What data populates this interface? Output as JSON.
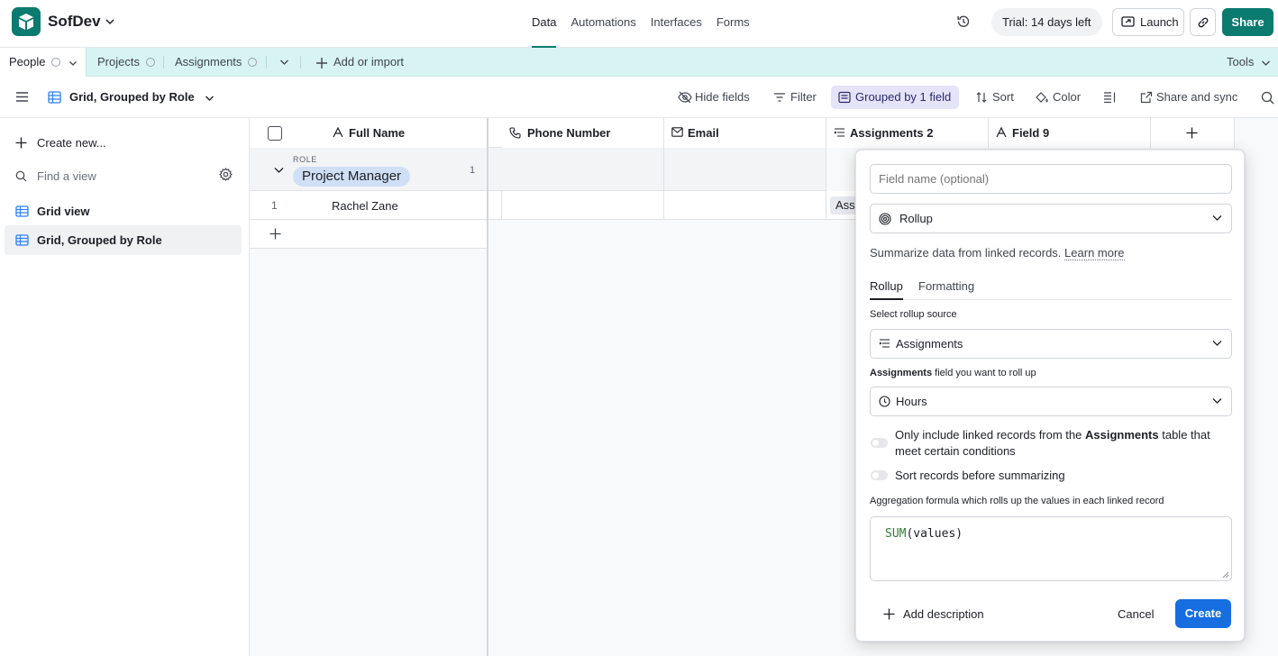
{
  "app": {
    "name": "SofDev"
  },
  "nav": {
    "tabs": [
      "Data",
      "Automations",
      "Interfaces",
      "Forms"
    ],
    "active": "Data"
  },
  "topright": {
    "trial": "Trial: 14 days left",
    "launch": "Launch",
    "share": "Share"
  },
  "tables": {
    "items": [
      "People",
      "Projects",
      "Assignments"
    ],
    "add": "Add or import",
    "tools": "Tools"
  },
  "viewbar": {
    "view_name": "Grid, Grouped by Role",
    "hide_fields": "Hide fields",
    "filter": "Filter",
    "grouped": "Grouped by 1 field",
    "sort": "Sort",
    "color": "Color",
    "share_sync": "Share and sync"
  },
  "sidebar": {
    "create": "Create new...",
    "find_placeholder": "Find a view",
    "views": [
      "Grid view",
      "Grid, Grouped by Role"
    ]
  },
  "grid": {
    "columns": [
      "Full Name",
      "Phone Number",
      "Email",
      "Assignments 2",
      "Field 9"
    ],
    "group_label": "ROLE",
    "group_value": "Project Manager",
    "group_count": "1",
    "rows": [
      {
        "num": "1",
        "full_name": "Rachel Zane",
        "assignments_partial": "Assi"
      }
    ]
  },
  "popover": {
    "field_name_placeholder": "Field name (optional)",
    "field_type": "Rollup",
    "description": "Summarize data from linked records.",
    "learn_more": "Learn more",
    "tabs": [
      "Rollup",
      "Formatting"
    ],
    "source_label": "Select rollup source",
    "source_value": "Assignments",
    "rollup_label_bold": "Assignments",
    "rollup_label_rest": " field you want to roll up",
    "rollup_field": "Hours",
    "toggle1_pre": "Only include linked records from the ",
    "toggle1_bold": "Assignments",
    "toggle1_post": " table that meet certain conditions",
    "toggle2": "Sort records before summarizing",
    "formula_label": "Aggregation formula which rolls up the values in each linked record",
    "formula_fn": "SUM",
    "formula_args": "(values)",
    "add_description": "Add description",
    "cancel": "Cancel",
    "create": "Create"
  },
  "colors": {
    "brand": "#0b7a6f",
    "tabs_bg": "#d7f4f2",
    "primary": "#166ee1",
    "group_pill": "#cfdff5"
  }
}
